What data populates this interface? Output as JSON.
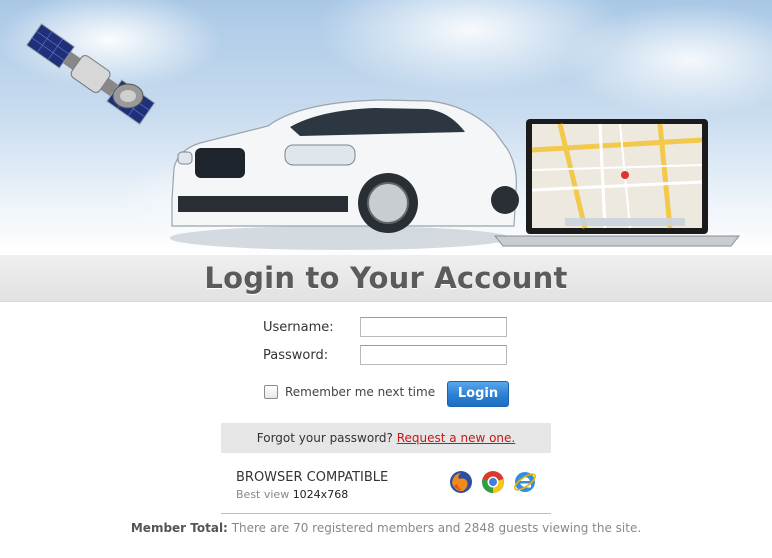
{
  "page": {
    "title": "Login to Your Account"
  },
  "form": {
    "username_label": "Username:",
    "username_value": "",
    "password_label": "Password:",
    "password_value": "",
    "remember_label": "Remember me next time",
    "remember_checked": false,
    "login_label": "Login"
  },
  "forgot": {
    "text": "Forgot your password?",
    "link": "Request a new one."
  },
  "compat": {
    "title": "BROWSER COMPATIBLE",
    "best_view_label": "Best view",
    "resolution": "1024x768",
    "browsers": [
      "firefox-icon",
      "chrome-icon",
      "ie-icon"
    ]
  },
  "footer": {
    "label": "Member Total:",
    "text": "There are 70 registered members and 2848 guests viewing the site."
  },
  "colors": {
    "title": "#5b5b5b",
    "button": "#2b7fd4",
    "link": "#c21818",
    "band": "#e6e6e6"
  }
}
